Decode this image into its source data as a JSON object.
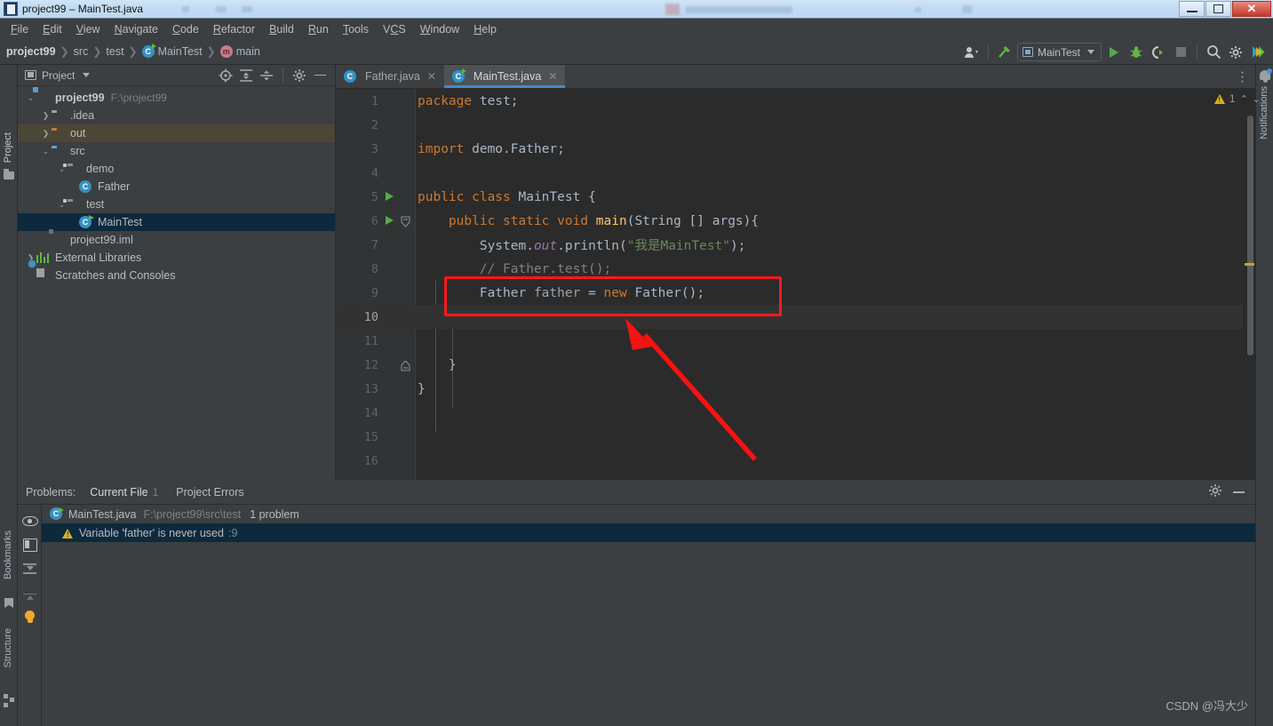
{
  "window": {
    "title": "project99 – MainTest.java",
    "app_icon": "idea-icon",
    "minimize_label": "—",
    "maximize_label": "❐",
    "close_label": "✕"
  },
  "menubar": {
    "items": [
      {
        "label": "File",
        "mnemonic": "F"
      },
      {
        "label": "Edit",
        "mnemonic": "E"
      },
      {
        "label": "View",
        "mnemonic": "V"
      },
      {
        "label": "Navigate",
        "mnemonic": "N"
      },
      {
        "label": "Code",
        "mnemonic": "C"
      },
      {
        "label": "Refactor",
        "mnemonic": "R"
      },
      {
        "label": "Build",
        "mnemonic": "B"
      },
      {
        "label": "Run",
        "mnemonic": "R"
      },
      {
        "label": "Tools",
        "mnemonic": "T"
      },
      {
        "label": "VCS",
        "mnemonic": "V"
      },
      {
        "label": "Window",
        "mnemonic": "W"
      },
      {
        "label": "Help",
        "mnemonic": "H"
      }
    ]
  },
  "navbar": {
    "breadcrumbs": [
      {
        "label": "project99",
        "icon": "",
        "bold": true
      },
      {
        "label": "src",
        "icon": ""
      },
      {
        "label": "test",
        "icon": ""
      },
      {
        "label": "MainTest",
        "icon": "java-class-icon"
      },
      {
        "label": "main",
        "icon": "method-icon"
      }
    ],
    "separator": "❯",
    "run_configuration": "MainTest",
    "toolbar_icons": [
      "user-avatar-icon",
      "build-hammer-icon",
      "run-icon",
      "debug-icon",
      "run-coverage-icon",
      "stop-icon",
      "search-icon",
      "settings-gear-icon",
      "idea-logo-icon"
    ]
  },
  "left_strip": {
    "project_label": "Project",
    "project_icon": "folder-icon"
  },
  "right_strip": {
    "notifications_label": "Notifications",
    "bell_icon": "bell-icon"
  },
  "bottom_left_strip": {
    "bookmarks_label": "Bookmarks",
    "bookmarks_icon": "bookmark-icon",
    "structure_label": "Structure",
    "structure_icon": "structure-icon"
  },
  "project_panel": {
    "title": "Project",
    "title_icon": "project-view-icon",
    "dropdown_icon": "chevron-down-icon",
    "toolbar_icons": [
      "select-opened-file-icon",
      "expand-all-icon",
      "collapse-all-icon",
      "settings-gear-icon",
      "hide-icon"
    ],
    "tree": [
      {
        "label": "project99",
        "secondary": "F:\\project99",
        "icon": "module-icon",
        "depth": 0,
        "arrow": "expanded",
        "bold": true,
        "state": "normal"
      },
      {
        "label": ".idea",
        "secondary": "",
        "icon": "folder-gray-icon",
        "depth": 1,
        "arrow": "collapsed",
        "bold": false,
        "state": "normal"
      },
      {
        "label": "out",
        "secondary": "",
        "icon": "folder-orange-icon",
        "depth": 1,
        "arrow": "collapsed",
        "bold": false,
        "state": "highlighted"
      },
      {
        "label": "src",
        "secondary": "",
        "icon": "folder-source-icon",
        "depth": 1,
        "arrow": "expanded",
        "bold": false,
        "state": "normal"
      },
      {
        "label": "demo",
        "secondary": "",
        "icon": "package-icon",
        "depth": 2,
        "arrow": "expanded",
        "bold": false,
        "state": "normal"
      },
      {
        "label": "Father",
        "secondary": "",
        "icon": "java-class-icon",
        "depth": 3,
        "arrow": "none",
        "bold": false,
        "state": "normal"
      },
      {
        "label": "test",
        "secondary": "",
        "icon": "package-icon",
        "depth": 2,
        "arrow": "expanded",
        "bold": false,
        "state": "normal"
      },
      {
        "label": "MainTest",
        "secondary": "",
        "icon": "java-class-runnable-icon",
        "depth": 3,
        "arrow": "none",
        "bold": false,
        "state": "selected"
      },
      {
        "label": "project99.iml",
        "secondary": "",
        "icon": "iml-file-icon",
        "depth": 1,
        "arrow": "none",
        "bold": false,
        "state": "normal"
      },
      {
        "label": "External Libraries",
        "secondary": "",
        "icon": "libraries-icon",
        "depth": 0,
        "arrow": "collapsed",
        "bold": false,
        "state": "normal"
      },
      {
        "label": "Scratches and Consoles",
        "secondary": "",
        "icon": "scratches-icon",
        "depth": 0,
        "arrow": "none",
        "bold": false,
        "state": "normal"
      }
    ]
  },
  "editor": {
    "tabs": [
      {
        "label": "Father.java",
        "icon": "java-class-icon",
        "active": false,
        "close_label": "✕"
      },
      {
        "label": "MainTest.java",
        "icon": "java-class-runnable-icon",
        "active": true,
        "close_label": "✕"
      }
    ],
    "more_icon": "more-vertical-icon",
    "inspection": {
      "warning_count": "1",
      "warning_icon": "warning-triangle-icon",
      "prev_icon": "chevron-up-icon",
      "next_icon": "chevron-down-icon"
    },
    "current_line": 10,
    "lines": [
      {
        "n": 1,
        "text": "package test;",
        "run_marker": false,
        "fold": false
      },
      {
        "n": 2,
        "text": "",
        "run_marker": false,
        "fold": false
      },
      {
        "n": 3,
        "text": "import demo.Father;",
        "run_marker": false,
        "fold": false
      },
      {
        "n": 4,
        "text": "",
        "run_marker": false,
        "fold": false
      },
      {
        "n": 5,
        "text": "public class MainTest {",
        "run_marker": true,
        "fold": false
      },
      {
        "n": 6,
        "text": "    public static void main(String [] args){",
        "run_marker": true,
        "fold": true
      },
      {
        "n": 7,
        "text": "        System.out.println(\"我是MainTest\");",
        "run_marker": false,
        "fold": false
      },
      {
        "n": 8,
        "text": "        // Father.test();",
        "run_marker": false,
        "fold": false
      },
      {
        "n": 9,
        "text": "        Father father = new Father();",
        "run_marker": false,
        "fold": false
      },
      {
        "n": 10,
        "text": "",
        "run_marker": false,
        "fold": false
      },
      {
        "n": 11,
        "text": "",
        "run_marker": false,
        "fold": false
      },
      {
        "n": 12,
        "text": "    }",
        "run_marker": false,
        "fold": true
      },
      {
        "n": 13,
        "text": "}",
        "run_marker": false,
        "fold": false
      },
      {
        "n": 14,
        "text": "",
        "run_marker": false,
        "fold": false
      },
      {
        "n": 15,
        "text": "",
        "run_marker": false,
        "fold": false
      },
      {
        "n": 16,
        "text": "",
        "run_marker": false,
        "fold": false
      }
    ]
  },
  "problems_panel": {
    "label": "Problems:",
    "tabs": [
      {
        "label": "Current File",
        "count": "1",
        "active": true
      },
      {
        "label": "Project Errors",
        "count": "",
        "active": false
      }
    ],
    "toolbar_icons": [
      "settings-gear-icon",
      "hide-icon"
    ],
    "side_icons": [
      "eye-preview-icon",
      "split-view-icon",
      "expand-all-icon",
      "collapse-all-icon",
      "lightbulb-icon"
    ],
    "file_row": {
      "icon": "java-class-runnable-icon",
      "name": "MainTest.java",
      "path": "F:\\project99\\src\\test",
      "summary": "1 problem"
    },
    "items": [
      {
        "icon": "warning-triangle-icon",
        "message": "Variable 'father' is never used",
        "location": ":9",
        "selected": true
      }
    ]
  },
  "annotations": {
    "highlight_box_color": "#fb1a1a",
    "arrow_color": "#fa1111",
    "watermark": "CSDN @冯大少"
  },
  "colors": {
    "background": "#3c3f41",
    "editor_background": "#2b2b2b",
    "gutter": "#313335",
    "selection": "#0d293e",
    "accent_blue": "#4a88c7",
    "keyword_orange": "#cc7832",
    "string_green": "#6a8759",
    "method_yellow": "#ffc66d",
    "text_default": "#a9b7c6",
    "comment_gray": "#808080",
    "warning_yellow": "#d9b020"
  }
}
